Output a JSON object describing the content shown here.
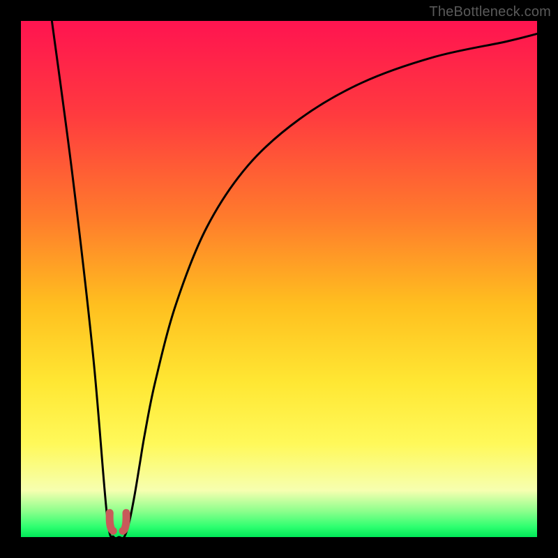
{
  "watermark": "TheBottleneck.com",
  "chart_data": {
    "type": "line",
    "title": "",
    "xlabel": "",
    "ylabel": "",
    "xlim": [
      0,
      100
    ],
    "ylim": [
      0,
      100
    ],
    "series": [
      {
        "name": "bottleneck-curve",
        "x": [
          6,
          10,
          14,
          16.7,
          18,
          19,
          20,
          21,
          22,
          23,
          24,
          26,
          30,
          36,
          44,
          54,
          66,
          80,
          94,
          100
        ],
        "values": [
          100,
          70,
          35,
          4,
          0,
          0,
          0,
          3,
          8,
          14,
          20,
          30,
          45,
          60,
          72,
          81,
          88,
          93,
          96,
          97.5
        ]
      }
    ],
    "markers": [
      {
        "name": "optimal-point-left",
        "x": 17.2,
        "y": 2.0
      },
      {
        "name": "optimal-point-right",
        "x": 20.4,
        "y": 2.0
      }
    ],
    "gradient_stops": [
      {
        "pos": 0,
        "color": "#ff1450"
      },
      {
        "pos": 18,
        "color": "#ff3a3f"
      },
      {
        "pos": 38,
        "color": "#ff7b2c"
      },
      {
        "pos": 55,
        "color": "#ffbf1f"
      },
      {
        "pos": 70,
        "color": "#ffe733"
      },
      {
        "pos": 82,
        "color": "#fff95a"
      },
      {
        "pos": 91,
        "color": "#f6ffb0"
      },
      {
        "pos": 95,
        "color": "#8cff8c"
      },
      {
        "pos": 98,
        "color": "#2eff70"
      },
      {
        "pos": 100,
        "color": "#00e858"
      }
    ]
  }
}
